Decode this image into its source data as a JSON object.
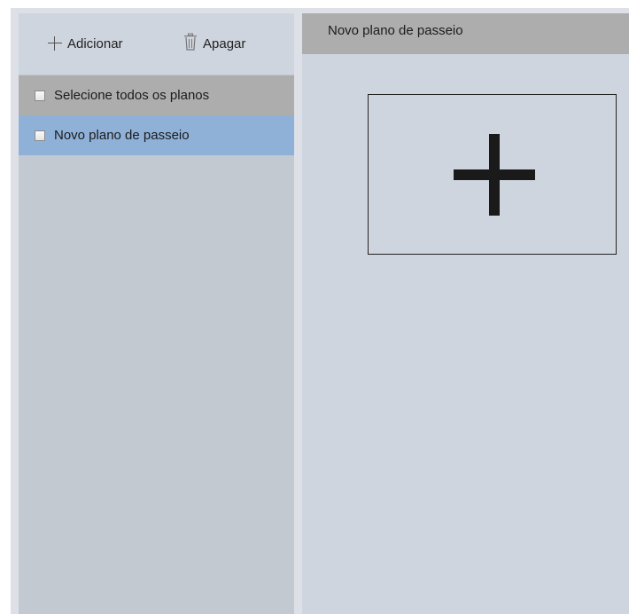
{
  "toolbar": {
    "add_label": "Adicionar",
    "delete_label": "Apagar"
  },
  "list": {
    "select_all_label": "Selecione todos os planos",
    "items": [
      {
        "label": "Novo plano de passeio",
        "selected": true
      }
    ]
  },
  "detail": {
    "title": "Novo plano de passeio"
  },
  "colors": {
    "selected_row": "#8fb1d8",
    "header_bg": "#adadad"
  }
}
